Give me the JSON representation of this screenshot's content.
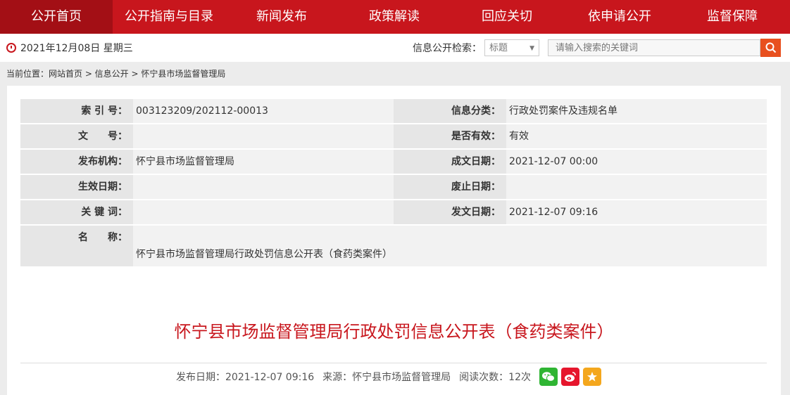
{
  "nav": [
    "公开首页",
    "公开指南与目录",
    "新闻发布",
    "政策解读",
    "回应关切",
    "依申请公开",
    "监督保障"
  ],
  "date": "2021年12月08日 星期三",
  "search": {
    "label": "信息公开检索：",
    "select_value": "标题",
    "placeholder": "请输入搜索的关键词"
  },
  "breadcrumb": "当前位置：网站首页 > 信息公开 > 怀宁县市场监督管理局",
  "info": {
    "index_label": "索 引 号：",
    "index_value": "003123209/202112-00013",
    "category_label": "信息分类：",
    "category_value": "行政处罚案件及违规名单",
    "docno_label": "文　　号：",
    "docno_value": "",
    "valid_label": "是否有效：",
    "valid_value": "有效",
    "org_label": "发布机构：",
    "org_value": "怀宁县市场监督管理局",
    "created_label": "成文日期：",
    "created_value": "2021-12-07 00:00",
    "effective_label": "生效日期：",
    "effective_value": "",
    "abolish_label": "废止日期：",
    "abolish_value": "",
    "keywords_label": "关 键 词：",
    "keywords_value": "",
    "publish_label": "发文日期：",
    "publish_value": "2021-12-07 09:16",
    "name_label": "名　　称：",
    "name_value": "怀宁县市场监督管理局行政处罚信息公开表（食药类案件）"
  },
  "article": {
    "title": "怀宁县市场监督管理局行政处罚信息公开表（食药类案件）",
    "publish_date": "发布日期：2021-12-07 09:16",
    "source": "来源：怀宁县市场监督管理局",
    "reads": "阅读次数：12次"
  },
  "colors": {
    "primary": "#c8161d",
    "search_button": "#e8501f",
    "wechat": "#2fb533",
    "weibo": "#e6162d",
    "favorite": "#f4a71d"
  }
}
